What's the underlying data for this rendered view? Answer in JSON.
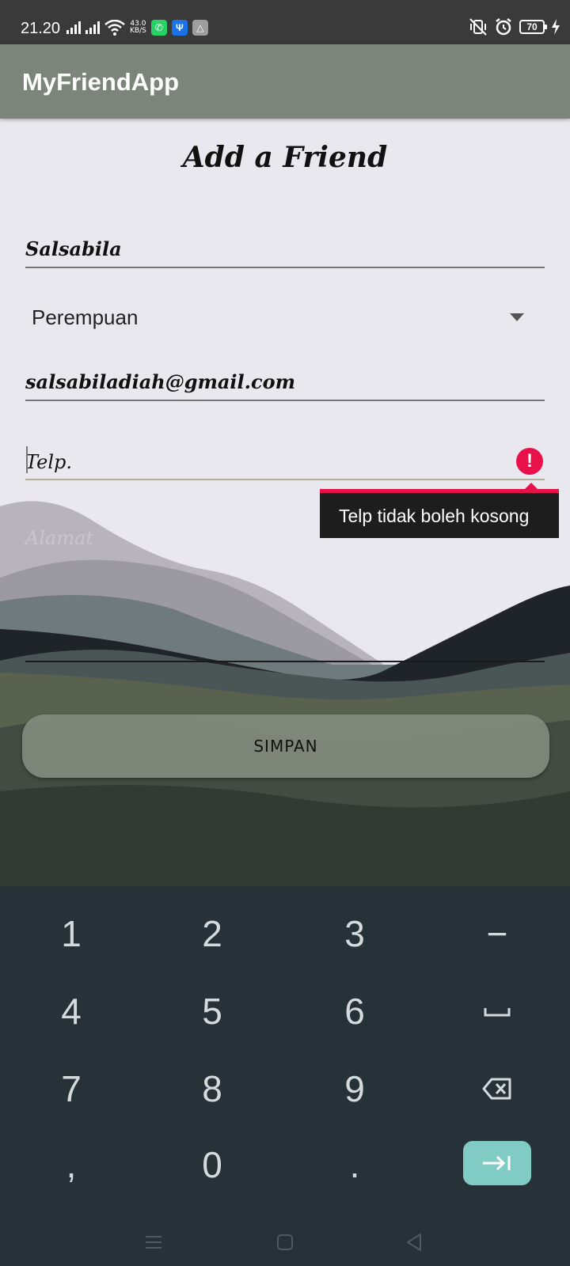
{
  "status_bar": {
    "time": "21.20",
    "net_speed_value": "43.0",
    "net_speed_unit": "KB/S",
    "battery": "70",
    "icons": [
      "signal-icon",
      "signal-icon",
      "wifi-icon",
      "whatsapp-icon",
      "usb-icon",
      "notification-icon",
      "mute-vibrate-icon",
      "alarm-icon",
      "battery-icon",
      "charging-icon"
    ]
  },
  "app_bar": {
    "title": "MyFriendApp"
  },
  "form": {
    "heading": "Add a Friend",
    "name_value": "Salsabila",
    "gender_value": "Perempuan",
    "email_value": "salsabiladiah@gmail.com",
    "phone_placeholder": "Telp.",
    "address_placeholder": "Alamat",
    "phone_error": "Telp tidak boleh kosong",
    "save_label": "SIMPAN"
  },
  "keyboard": {
    "keys": [
      "1",
      "2",
      "3",
      "−",
      "4",
      "5",
      "6",
      "␣",
      "7",
      "8",
      "9",
      "⌫",
      ",",
      "0",
      ".",
      "⇥"
    ]
  },
  "colors": {
    "status_bar": "#3a3a3a",
    "app_bar": "#7b857a",
    "background": "#e9e8ee",
    "error": "#e8114a",
    "keyboard": "#263238",
    "enter_key": "#80cbc4"
  }
}
